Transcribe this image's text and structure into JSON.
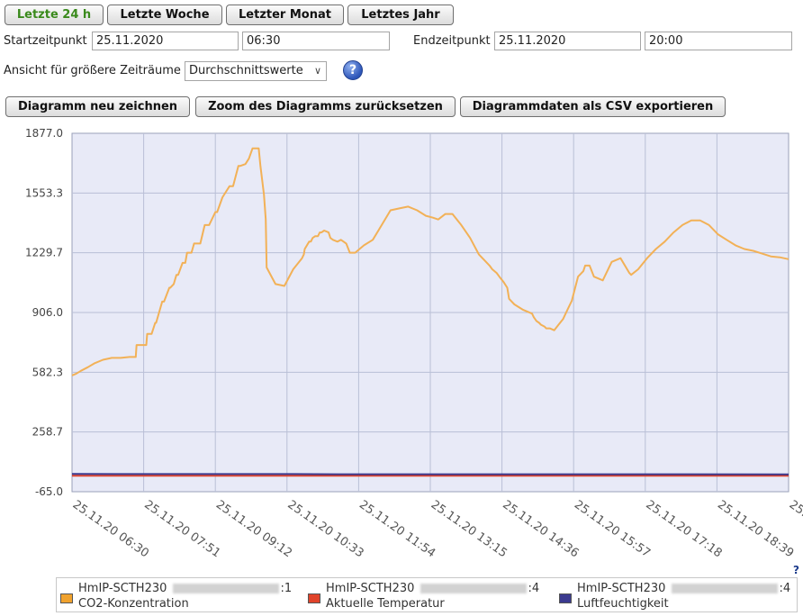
{
  "range_buttons": [
    "Letzte 24 h",
    "Letzte Woche",
    "Letzter Monat",
    "Letztes Jahr"
  ],
  "start": {
    "label": "Startzeitpunkt",
    "date": "25.11.2020",
    "time": "06:30"
  },
  "end": {
    "label": "Endzeitpunkt",
    "date": "25.11.2020",
    "time": "20:00"
  },
  "view": {
    "label": "Ansicht für größere Zeiträume",
    "value": "Durchschnittswerte"
  },
  "help_icon": "?",
  "actions": {
    "redraw": "Diagramm neu zeichnen",
    "reset_zoom": "Zoom des Diagramms zurücksetzen",
    "export_csv": "Diagrammdaten als CSV exportieren"
  },
  "corner_help": "?",
  "legend": [
    {
      "device": "HmIP-SCTH230",
      "channel": ":1",
      "name": "CO2-Konzentration",
      "color": "#f0a22e"
    },
    {
      "device": "HmIP-SCTH230",
      "channel": ":4",
      "name": "Aktuelle Temperatur",
      "color": "#e0432a"
    },
    {
      "device": "HmIP-SCTH230",
      "channel": ":4",
      "name": "Luftfeuchtigkeit",
      "color": "#3b3a8f"
    }
  ],
  "colors": {
    "plot_bg": "#e8eaf7",
    "grid": "#b9bfd6",
    "co2": "#f2b157",
    "temp": "#e0432a",
    "hum": "#3b3a8f",
    "active_button": "#3a8a1c"
  },
  "chart_data": {
    "type": "line",
    "y_ticks": [
      "1877.0",
      "1553.3",
      "1229.7",
      "906.0",
      "582.3",
      "258.7",
      "-65.0"
    ],
    "ylim": [
      -65.0,
      1877.0
    ],
    "x_ticks": [
      "25.11.20 06:30",
      "25.11.20 07:51",
      "25.11.20 09:12",
      "25.11.20 10:33",
      "25.11.20 11:54",
      "25.11.20 13:15",
      "25.11.20 14:36",
      "25.11.20 15:57",
      "25.11.20 17:18",
      "25.11.20 18:39",
      "25."
    ],
    "xlim_minutes": [
      0,
      810
    ],
    "grid": true,
    "series": [
      {
        "name": "CO2-Konzentration",
        "x_minutes": [
          0,
          5,
          10,
          18,
          25,
          35,
          45,
          55,
          65,
          72,
          73,
          80,
          84,
          85,
          90,
          94,
          95,
          102,
          104,
          110,
          111,
          115,
          118,
          120,
          125,
          128,
          130,
          135,
          138,
          140,
          145,
          150,
          153,
          155,
          162,
          164,
          170,
          178,
          182,
          188,
          190,
          196,
          200,
          204,
          208,
          211,
          213,
          217,
          219,
          220,
          230,
          240,
          250,
          255,
          260,
          262,
          263,
          268,
          270,
          272,
          275,
          278,
          280,
          282,
          285,
          290,
          292,
          295,
          300,
          304,
          310,
          314,
          320,
          330,
          340,
          350,
          360,
          370,
          380,
          390,
          400,
          408,
          414,
          422,
          430,
          440,
          450,
          460,
          468,
          472,
          475,
          480,
          483,
          488,
          492,
          494,
          500,
          510,
          520,
          522,
          525,
          528,
          530,
          534,
          536,
          540,
          545,
          550,
          555,
          560,
          565,
          572,
          578,
          580,
          585,
          590,
          600,
          610,
          620,
          630,
          632,
          640,
          650,
          660,
          670,
          680,
          690,
          700,
          710,
          720,
          730,
          740,
          750,
          760,
          770,
          780,
          790,
          800,
          810
        ],
        "values": [
          565,
          575,
          590,
          610,
          630,
          650,
          660,
          660,
          665,
          665,
          730,
          730,
          730,
          790,
          790,
          850,
          850,
          965,
          965,
          1040,
          1040,
          1060,
          1110,
          1110,
          1175,
          1175,
          1230,
          1230,
          1280,
          1280,
          1280,
          1380,
          1380,
          1380,
          1450,
          1450,
          1530,
          1590,
          1590,
          1700,
          1700,
          1710,
          1740,
          1795,
          1795,
          1795,
          1700,
          1545,
          1410,
          1150,
          1060,
          1050,
          1140,
          1170,
          1200,
          1220,
          1250,
          1290,
          1290,
          1310,
          1320,
          1320,
          1340,
          1340,
          1350,
          1340,
          1310,
          1300,
          1290,
          1300,
          1280,
          1230,
          1230,
          1270,
          1300,
          1380,
          1460,
          1470,
          1480,
          1460,
          1430,
          1420,
          1410,
          1440,
          1440,
          1380,
          1310,
          1220,
          1180,
          1160,
          1140,
          1120,
          1100,
          1070,
          1040,
          980,
          950,
          920,
          900,
          880,
          860,
          850,
          840,
          830,
          820,
          820,
          810,
          840,
          870,
          920,
          970,
          1100,
          1130,
          1160,
          1160,
          1100,
          1080,
          1180,
          1200,
          1120,
          1110,
          1140,
          1200,
          1250,
          1290,
          1340,
          1380,
          1405,
          1405,
          1380,
          1330,
          1300,
          1270,
          1250,
          1240,
          1225,
          1210,
          1205,
          1195,
          1185,
          1175,
          1165,
          1135
        ]
      },
      {
        "name": "Aktuelle Temperatur",
        "x_minutes": [
          0,
          250,
          400,
          810
        ],
        "values": [
          21.5,
          21.3,
          21.6,
          21.8
        ]
      },
      {
        "name": "Luftfeuchtigkeit",
        "x_minutes": [
          0,
          250,
          300,
          810
        ],
        "values": [
          31.0,
          30.5,
          29.5,
          29.2
        ]
      }
    ]
  }
}
